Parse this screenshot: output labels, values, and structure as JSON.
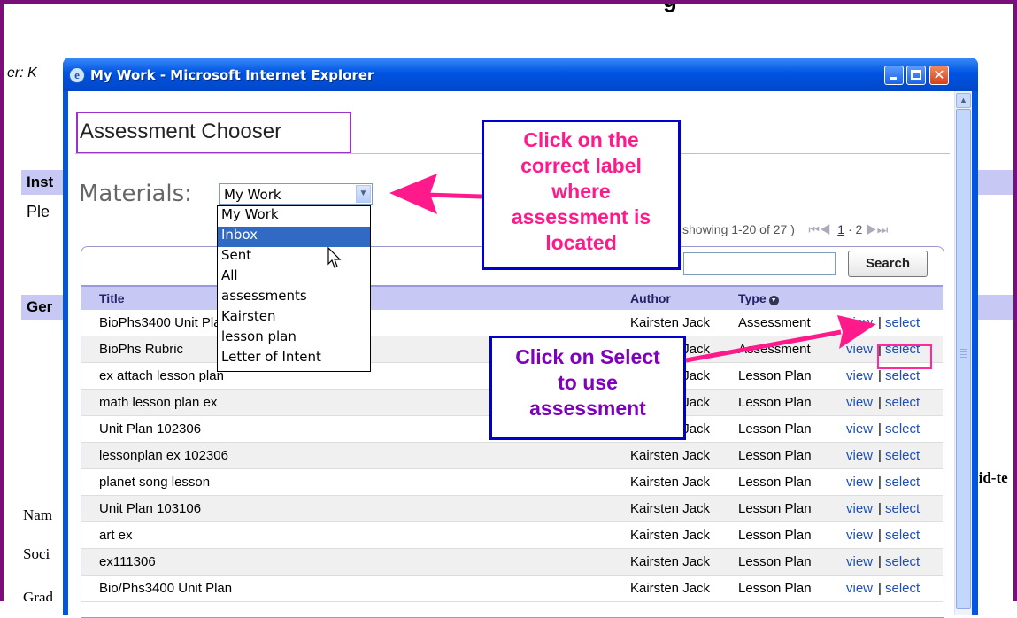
{
  "background": {
    "header_fragment": "g",
    "reviewer_fragment": "er: K",
    "section1_label": "Inst",
    "section1_text": "Ple",
    "section2_label": "Ger",
    "mid_fragment": "Iid-te",
    "name_label": "Nam",
    "soci_label": "Soci",
    "grad_label": "Grad"
  },
  "window": {
    "title": "My Work - Microsoft Internet Explorer",
    "icon": "ie-logo-icon",
    "close_glyph": "✕"
  },
  "chooser": {
    "title": "Assessment Chooser",
    "materials_label": "Materials:",
    "selected_value": "My Work",
    "dropdown_options": [
      "My Work",
      "Inbox",
      "Sent",
      "All",
      "assessments",
      "Kairsten",
      "lesson plan",
      "Letter of Intent"
    ],
    "highlighted_option": "Inbox"
  },
  "paging": {
    "showing": "showing 1-20 of 27 )",
    "first_prev": "⏮◀",
    "page1": "1",
    "dot": "·",
    "page2": "2",
    "next_last": "▶⏭"
  },
  "search": {
    "button_label": "Search",
    "value": ""
  },
  "table": {
    "headers": {
      "title": "Title",
      "author": "Author",
      "type": "Type"
    },
    "action_view": "view",
    "action_sep": "|",
    "action_select": "select",
    "rows": [
      {
        "title": "BioPhs3400 Unit Plan",
        "author": "Kairsten Jack",
        "type": "Assessment"
      },
      {
        "title": "BioPhs Rubric",
        "author": "Kairsten Jack",
        "type": "Assessment"
      },
      {
        "title": "ex attach lesson plan",
        "author": "Kairsten Jack",
        "type": "Lesson Plan"
      },
      {
        "title": "math lesson plan ex",
        "author": "Kairsten Jack",
        "type": "Lesson Plan"
      },
      {
        "title": "Unit Plan 102306",
        "author": "Kairsten Jack",
        "type": "Lesson Plan"
      },
      {
        "title": "lessonplan ex 102306",
        "author": "Kairsten Jack",
        "type": "Lesson Plan"
      },
      {
        "title": "planet song lesson",
        "author": "Kairsten Jack",
        "type": "Lesson Plan"
      },
      {
        "title": "Unit Plan 103106",
        "author": "Kairsten Jack",
        "type": "Lesson Plan"
      },
      {
        "title": "art ex",
        "author": "Kairsten Jack",
        "type": "Lesson Plan"
      },
      {
        "title": "ex111306",
        "author": "Kairsten Jack",
        "type": "Lesson Plan"
      },
      {
        "title": "Bio/Phs3400 Unit Plan",
        "author": "Kairsten Jack",
        "type": "Lesson Plan"
      }
    ]
  },
  "callouts": {
    "label_hint": [
      "Click on the",
      "correct label",
      "where",
      "assessment is",
      "located"
    ],
    "select_hint": [
      "Click on Select",
      "to use",
      "assessment"
    ]
  },
  "colors": {
    "frame": "#7a0f7a",
    "callout_border": "#0000cc",
    "hint_pink": "#ff1a8c",
    "hint_purple": "#8000c0",
    "title_border": "#9933cc",
    "header_bg": "#c8c8f4"
  }
}
